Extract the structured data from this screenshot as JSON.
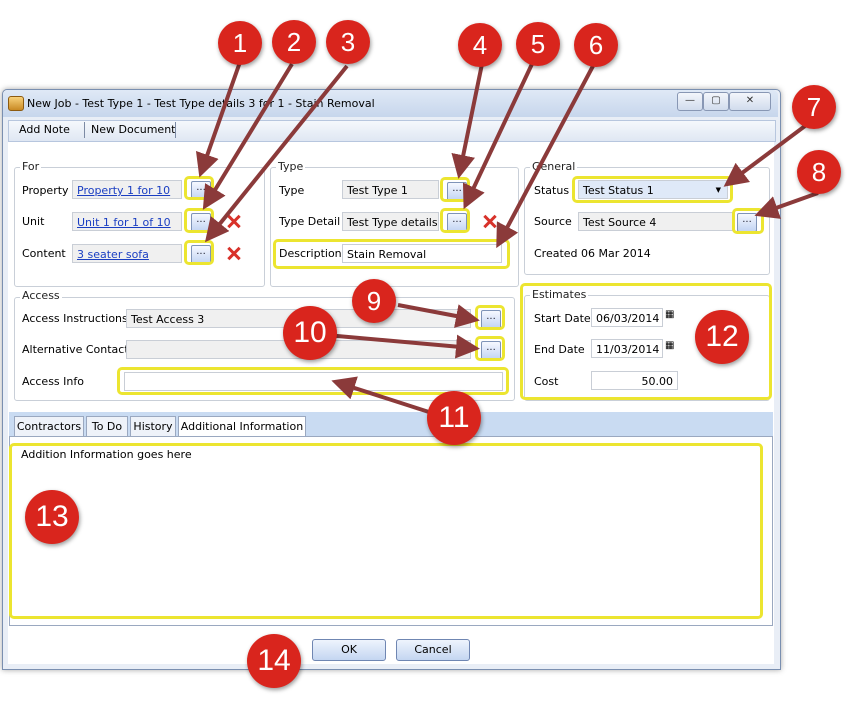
{
  "window": {
    "title": "New Job - Test Type 1 - Test Type details 3 for 1 - Stain Removal",
    "minimize": "—",
    "maximize": "▢",
    "close": "✕"
  },
  "toolbar": {
    "add_note": "Add Note",
    "new_document": "New Document"
  },
  "for_group": {
    "label": "For",
    "property_label": "Property",
    "property_value": "Property 1 for 10",
    "unit_label": "Unit",
    "unit_value": "Unit 1 for 1 of 10",
    "content_label": "Content",
    "content_value": "3 seater sofa"
  },
  "type_group": {
    "label": "Type",
    "type_label": "Type",
    "type_value": "Test Type 1",
    "detail_label": "Type Detail",
    "detail_value": "Test Type details",
    "description_label": "Description",
    "description_value": "Stain Removal"
  },
  "general_group": {
    "label": "General",
    "status_label": "Status",
    "status_value": "Test Status 1",
    "source_label": "Source",
    "source_value": "Test Source 4",
    "created_text": "Created 06 Mar 2014"
  },
  "access_group": {
    "label": "Access",
    "instructions_label": "Access Instructions",
    "instructions_value": "Test Access 3",
    "alt_contact_label": "Alternative Contact",
    "alt_contact_value": "",
    "info_label": "Access Info",
    "info_value": ""
  },
  "estimates_group": {
    "label": "Estimates",
    "start_label": "Start Date",
    "start_value": "06/03/2014",
    "end_label": "End Date",
    "end_value": "11/03/2014",
    "cost_label": "Cost",
    "cost_value": "50.00"
  },
  "tabs": [
    {
      "label": "Contractors"
    },
    {
      "label": "To Do"
    },
    {
      "label": "History"
    },
    {
      "label": "Additional Information"
    }
  ],
  "additional_info_text": "Addition Information goes here",
  "buttons": {
    "ok": "OK",
    "cancel": "Cancel",
    "dots": "..."
  },
  "callouts": [
    "1",
    "2",
    "3",
    "4",
    "5",
    "6",
    "7",
    "8",
    "9",
    "10",
    "11",
    "12",
    "13",
    "14"
  ],
  "colors": {
    "callout": "#d9251d",
    "highlight": "#ece530",
    "arrow": "#8b3a3a"
  }
}
